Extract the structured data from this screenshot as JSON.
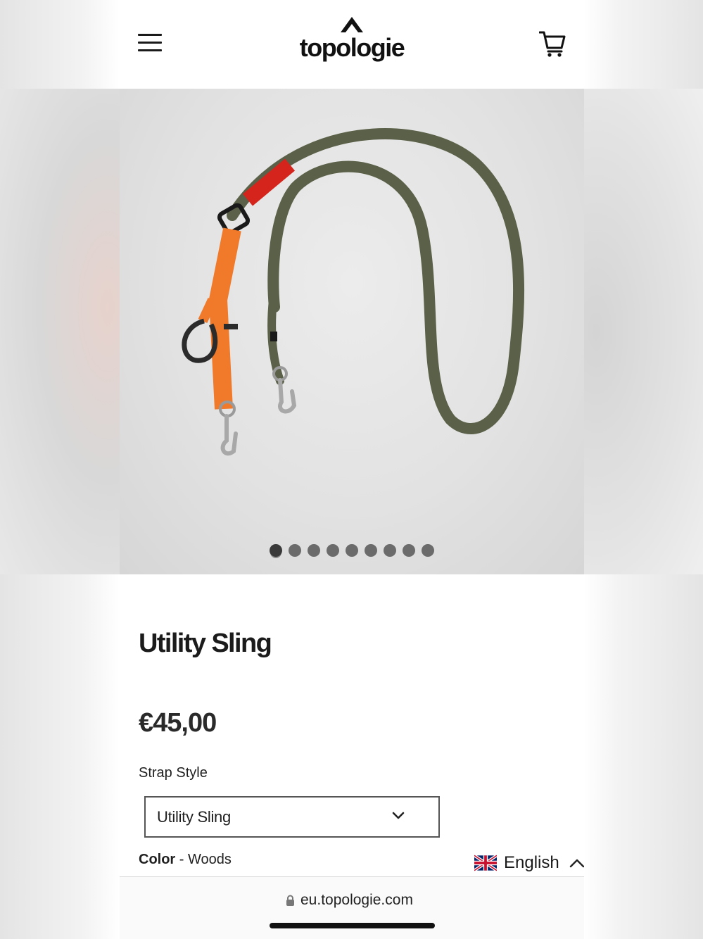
{
  "header": {
    "brand": "topologie"
  },
  "gallery": {
    "slide_count": 9,
    "active_slide": 1
  },
  "product": {
    "title": "Utility Sling",
    "price": "€45,00",
    "strap_style_label": "Strap Style",
    "strap_style_value": "Utility Sling",
    "color_label": "Color",
    "color_separator": " - ",
    "color_value": "Woods"
  },
  "language": {
    "label": "English"
  },
  "browser": {
    "url": "eu.topologie.com"
  },
  "icons": {
    "menu": "hamburger-menu-icon",
    "cart": "shopping-cart-icon",
    "select": "chevron-down-icon",
    "language": "chevron-up-icon",
    "flag": "uk-flag-icon",
    "lock": "lock-icon"
  },
  "colors": {
    "strap_olive": "#5a6148",
    "strap_orange": "#f07a2a",
    "label_red": "#d4241c",
    "text": "#1b1b1b"
  }
}
